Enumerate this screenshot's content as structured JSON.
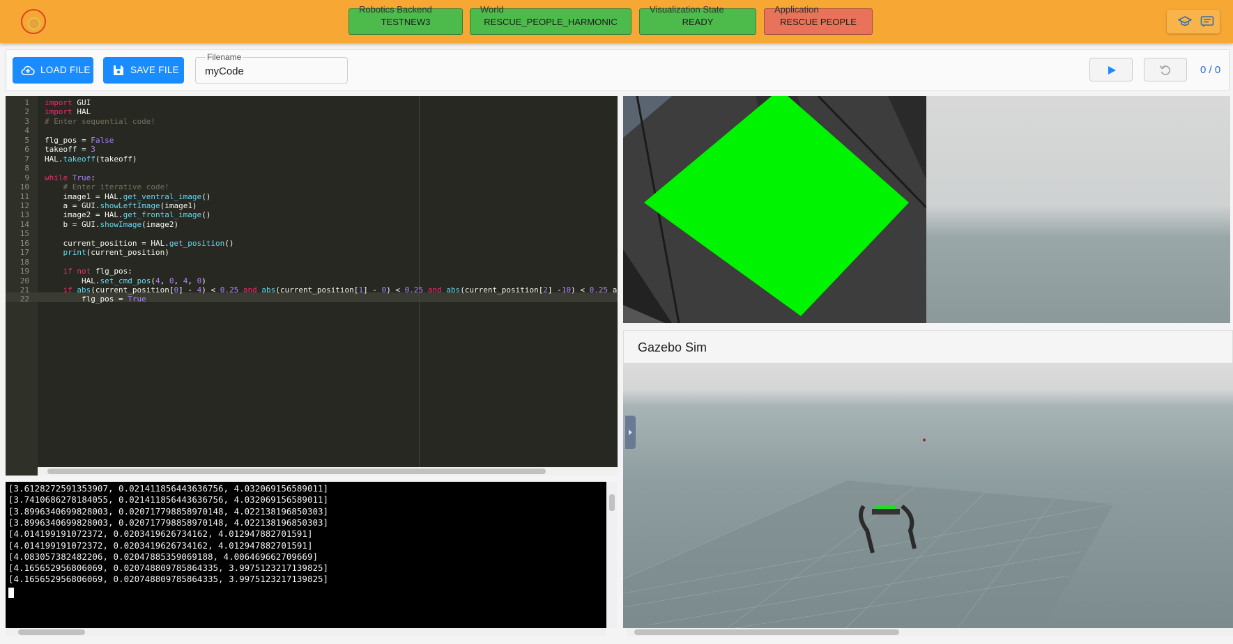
{
  "header": {
    "chips": [
      {
        "label": "Robotics Backend",
        "value": "TESTNEW3",
        "color": "#4cbb4c"
      },
      {
        "label": "World",
        "value": "RESCUE_PEOPLE_HARMONIC",
        "color": "#4cbb4c"
      },
      {
        "label": "Visualization State",
        "value": "READY",
        "color": "#4cbb4c"
      },
      {
        "label": "Application",
        "value": "RESCUE PEOPLE",
        "color": "#e8735a"
      }
    ],
    "icons": [
      "graduation-cap-icon",
      "chat-icon"
    ]
  },
  "toolbar": {
    "load_label": "LOAD FILE",
    "save_label": "SAVE FILE",
    "filename_label": "Filename",
    "filename_value": "myCode",
    "counter": "0 / 0"
  },
  "editor": {
    "lines": [
      "import GUI",
      "import HAL",
      "# Enter sequential code!",
      "",
      "flg_pos = False",
      "takeoff = 3",
      "HAL.takeoff(takeoff)",
      "",
      "while True:",
      "    # Enter iterative code!",
      "    image1 = HAL.get_ventral_image()",
      "    a = GUI.showLeftImage(image1)",
      "    image2 = HAL.get_frontal_image()",
      "    b = GUI.showImage(image2)",
      "",
      "    current_position = HAL.get_position()",
      "    print(current_position)",
      "",
      "    if not flg_pos:",
      "        HAL.set_cmd_pos(4, 0, 4, 0)",
      "    if abs(current_position[0] - 4) < 0.25 and abs(current_position[1] - 0) < 0.25 and abs(current_position[2] -10) < 0.25 a",
      "        flg_pos = True"
    ],
    "zoom_in": "+",
    "zoom_out": "−"
  },
  "console": {
    "lines": [
      "[3.6128272591353907, 0.021411856443636756, 4.032069156589011]",
      "[3.7410686278184055, 0.021411856443636756, 4.032069156589011]",
      "[3.8996340699828003, 0.020717798858970148, 4.022138196850303]",
      "[3.8996340699828003, 0.020717798858970148, 4.022138196850303]",
      "[4.014199191072372, 0.0203419626734162, 4.012947882701591]",
      "[4.014199191072372, 0.0203419626734162, 4.012947882701591]",
      "[4.083057382482206, 0.02047885359069188, 4.006469662709669]",
      "[4.165652956806069, 0.020748809785864335, 3.9975123217139825]",
      "[4.165652956806069, 0.020748809785864335, 3.9975123217139825]"
    ]
  },
  "gazebo": {
    "title": "Gazebo Sim"
  }
}
